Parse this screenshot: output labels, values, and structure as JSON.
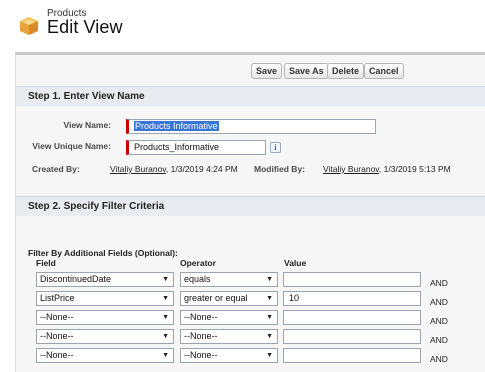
{
  "header": {
    "object_label": "Products",
    "title": "Edit View",
    "icon": "products-box-icon"
  },
  "toolbar": {
    "save": "Save",
    "save_as": "Save As",
    "delete": "Delete",
    "cancel": "Cancel"
  },
  "step1": {
    "title": "Step 1. Enter View Name",
    "view_name_label": "View Name:",
    "view_name_value": "Products Informative",
    "unique_name_label": "View Unique Name:",
    "unique_name_value": "Products_Informative",
    "info_glyph": "i",
    "created_by_label": "Created By:",
    "created_by_user": "Vitaliy Buranov",
    "created_by_date": ", 1/3/2019 4:24 PM",
    "modified_by_label": "Modified By:",
    "modified_by_user": "Vitaliy Buranov",
    "modified_by_date": ", 1/3/2019 5:13 PM"
  },
  "step2": {
    "title": "Step 2. Specify Filter Criteria",
    "subheading": "Filter By Additional Fields (Optional):",
    "col_field": "Field",
    "col_operator": "Operator",
    "col_value": "Value",
    "rows": [
      {
        "field": "DiscontinuedDate",
        "operator": "equals",
        "value": "",
        "join": "AND"
      },
      {
        "field": "ListPrice",
        "operator": "greater or equal",
        "value": "10",
        "join": "AND"
      },
      {
        "field": "--None--",
        "operator": "--None--",
        "value": "",
        "join": "AND"
      },
      {
        "field": "--None--",
        "operator": "--None--",
        "value": "",
        "join": "AND"
      },
      {
        "field": "--None--",
        "operator": "--None--",
        "value": "",
        "join": "AND"
      }
    ]
  }
}
